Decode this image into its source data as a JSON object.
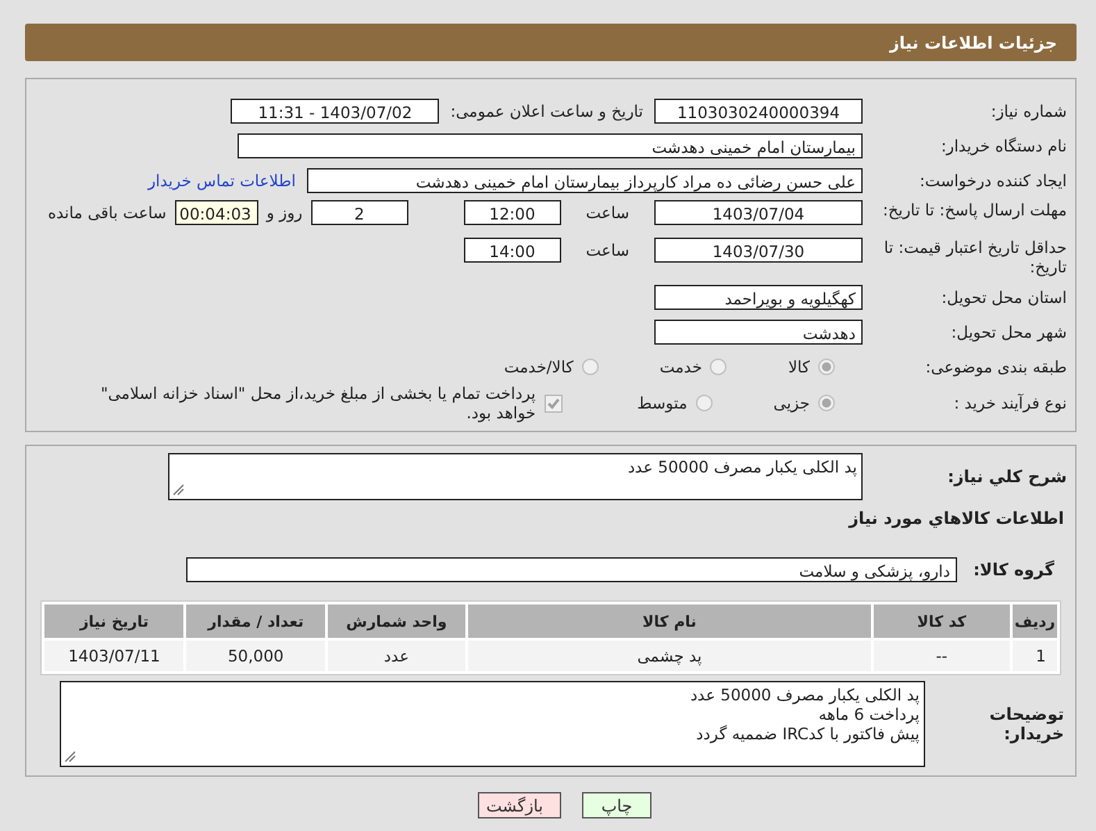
{
  "header": {
    "title": "جزئیات اطلاعات نیاز"
  },
  "need_number": {
    "label": "شماره نیاز:",
    "value": "1103030240000394"
  },
  "announce_date": {
    "label": "تاریخ و ساعت اعلان عمومی:",
    "value": "1403/07/02 - 11:31"
  },
  "buyer_org": {
    "label": "نام دستگاه خریدار:",
    "value": "بیمارستان امام خمینی دهدشت"
  },
  "requester": {
    "label": "ایجاد کننده درخواست:",
    "value": "علی حسن رضائی ده مراد کارپرداز بیمارستان امام خمینی دهدشت",
    "link": "اطلاعات تماس خریدار"
  },
  "reply_deadline": {
    "label": "مهلت ارسال پاسخ: تا تاریخ:",
    "date": "1403/07/04",
    "time_label": "ساعت",
    "time": "12:00",
    "days": "2",
    "days_label": "روز و",
    "remaining": "00:04:03",
    "remaining_label": "ساعت باقی مانده"
  },
  "price_validity": {
    "label": "حداقل تاریخ اعتبار قیمت: تا تاریخ:",
    "date": "1403/07/30",
    "time_label": "ساعت",
    "time": "14:00"
  },
  "province": {
    "label": "استان محل تحویل:",
    "value": "کهگیلویه و بویراحمد"
  },
  "city": {
    "label": "شهر محل تحویل:",
    "value": "دهدشت"
  },
  "category": {
    "label": "طبقه بندی موضوعی:",
    "options": [
      {
        "label": "کالا",
        "selected": true
      },
      {
        "label": "خدمت",
        "selected": false
      },
      {
        "label": "کالا/خدمت",
        "selected": false
      }
    ]
  },
  "purchase_type": {
    "label": "نوع فرآیند خرید :",
    "options": [
      {
        "label": "جزیی",
        "selected": true
      },
      {
        "label": "متوسط",
        "selected": false
      }
    ],
    "treasury": {
      "checked": true,
      "label": "پرداخت تمام یا بخشی از مبلغ خرید،از محل \"اسناد خزانه اسلامی\" خواهد بود."
    }
  },
  "summary": {
    "label": "شرح کلي نياز:",
    "value": "پد الکلی یکبار مصرف 50000 عدد"
  },
  "goods_heading": "اطلاعات كالاهاي مورد نياز",
  "goods_group": {
    "label": "گروه کالا:",
    "value": "دارو، پزشکی و سلامت"
  },
  "table": {
    "columns": [
      "رديف",
      "کد کالا",
      "نام کالا",
      "واحد شمارش",
      "تعداد / مقدار",
      "تاریخ نیاز"
    ],
    "rows": [
      [
        "1",
        "--",
        "پد چشمی",
        "عدد",
        "50,000",
        "1403/07/11"
      ]
    ]
  },
  "buyer_notes": {
    "label": "توضیحات خریدار:",
    "lines": [
      "پد الکلی یکبار مصرف 50000 عدد",
      "پرداخت 6 ماهه",
      "پیش فاکتور با کدIRC ضممیه گردد"
    ]
  },
  "buttons": [
    {
      "label": "چاپ",
      "kind": "print"
    },
    {
      "label": "بازگشت",
      "kind": "back"
    }
  ]
}
